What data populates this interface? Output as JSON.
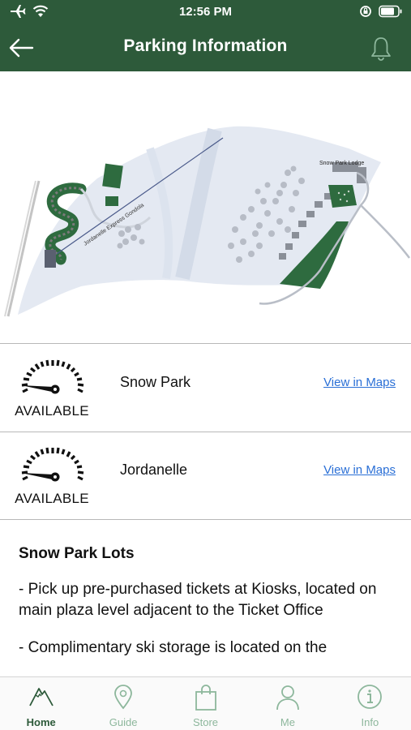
{
  "status_bar": {
    "time": "12:56 PM"
  },
  "header": {
    "title": "Parking Information"
  },
  "map": {
    "labels": {
      "lodge": "Snow Park Lodge",
      "gondola": "Jordanelle Express Gondola"
    }
  },
  "lots": [
    {
      "status": "AVAILABLE",
      "name": "Snow Park",
      "link": "View in Maps"
    },
    {
      "status": "AVAILABLE",
      "name": "Jordanelle",
      "link": "View in Maps"
    }
  ],
  "info": {
    "heading": "Snow Park Lots",
    "paragraphs": [
      "- Pick up pre-purchased tickets at Kiosks, located on main plaza level adjacent to the Ticket Office",
      "- Complimentary ski storage is located on the"
    ]
  },
  "tabs": [
    {
      "label": "Home",
      "icon": "mountain-icon"
    },
    {
      "label": "Guide",
      "icon": "map-pin-icon"
    },
    {
      "label": "Store",
      "icon": "shopping-bag-icon"
    },
    {
      "label": "Me",
      "icon": "person-icon"
    },
    {
      "label": "Info",
      "icon": "info-icon"
    }
  ],
  "colors": {
    "brand": "#2d5a3a",
    "link": "#2a6fd6",
    "tab_inactive": "#8db79c",
    "lot_green": "#2e6b3f"
  }
}
